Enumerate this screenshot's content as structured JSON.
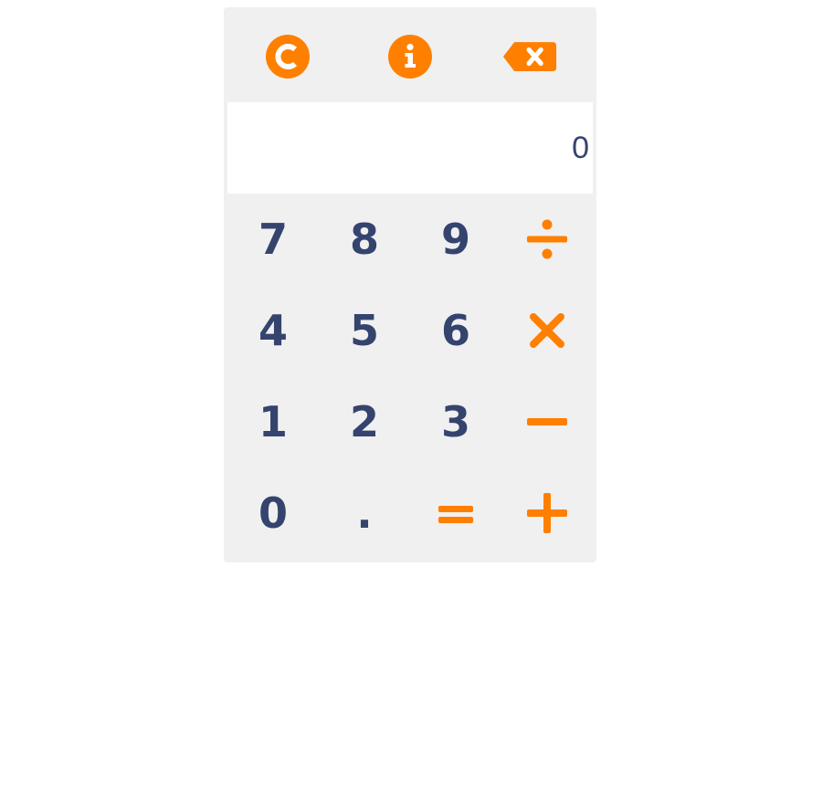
{
  "colors": {
    "accent": "#ff7f00",
    "digits": "#34446e",
    "panel": "#f0f0f0",
    "display_bg": "#ffffff"
  },
  "toolbar": {
    "clear_icon": "clear-c-icon",
    "info_icon": "info-icon",
    "backspace_icon": "backspace-icon"
  },
  "display": {
    "value": "0"
  },
  "keys": {
    "seven": "7",
    "eight": "8",
    "nine": "9",
    "divide_icon": "divide-icon",
    "four": "4",
    "five": "5",
    "six": "6",
    "multiply_icon": "multiply-icon",
    "one": "1",
    "two": "2",
    "three": "3",
    "minus_icon": "minus-icon",
    "zero": "0",
    "dot": ".",
    "equals_icon": "equals-icon",
    "plus_icon": "plus-icon"
  }
}
